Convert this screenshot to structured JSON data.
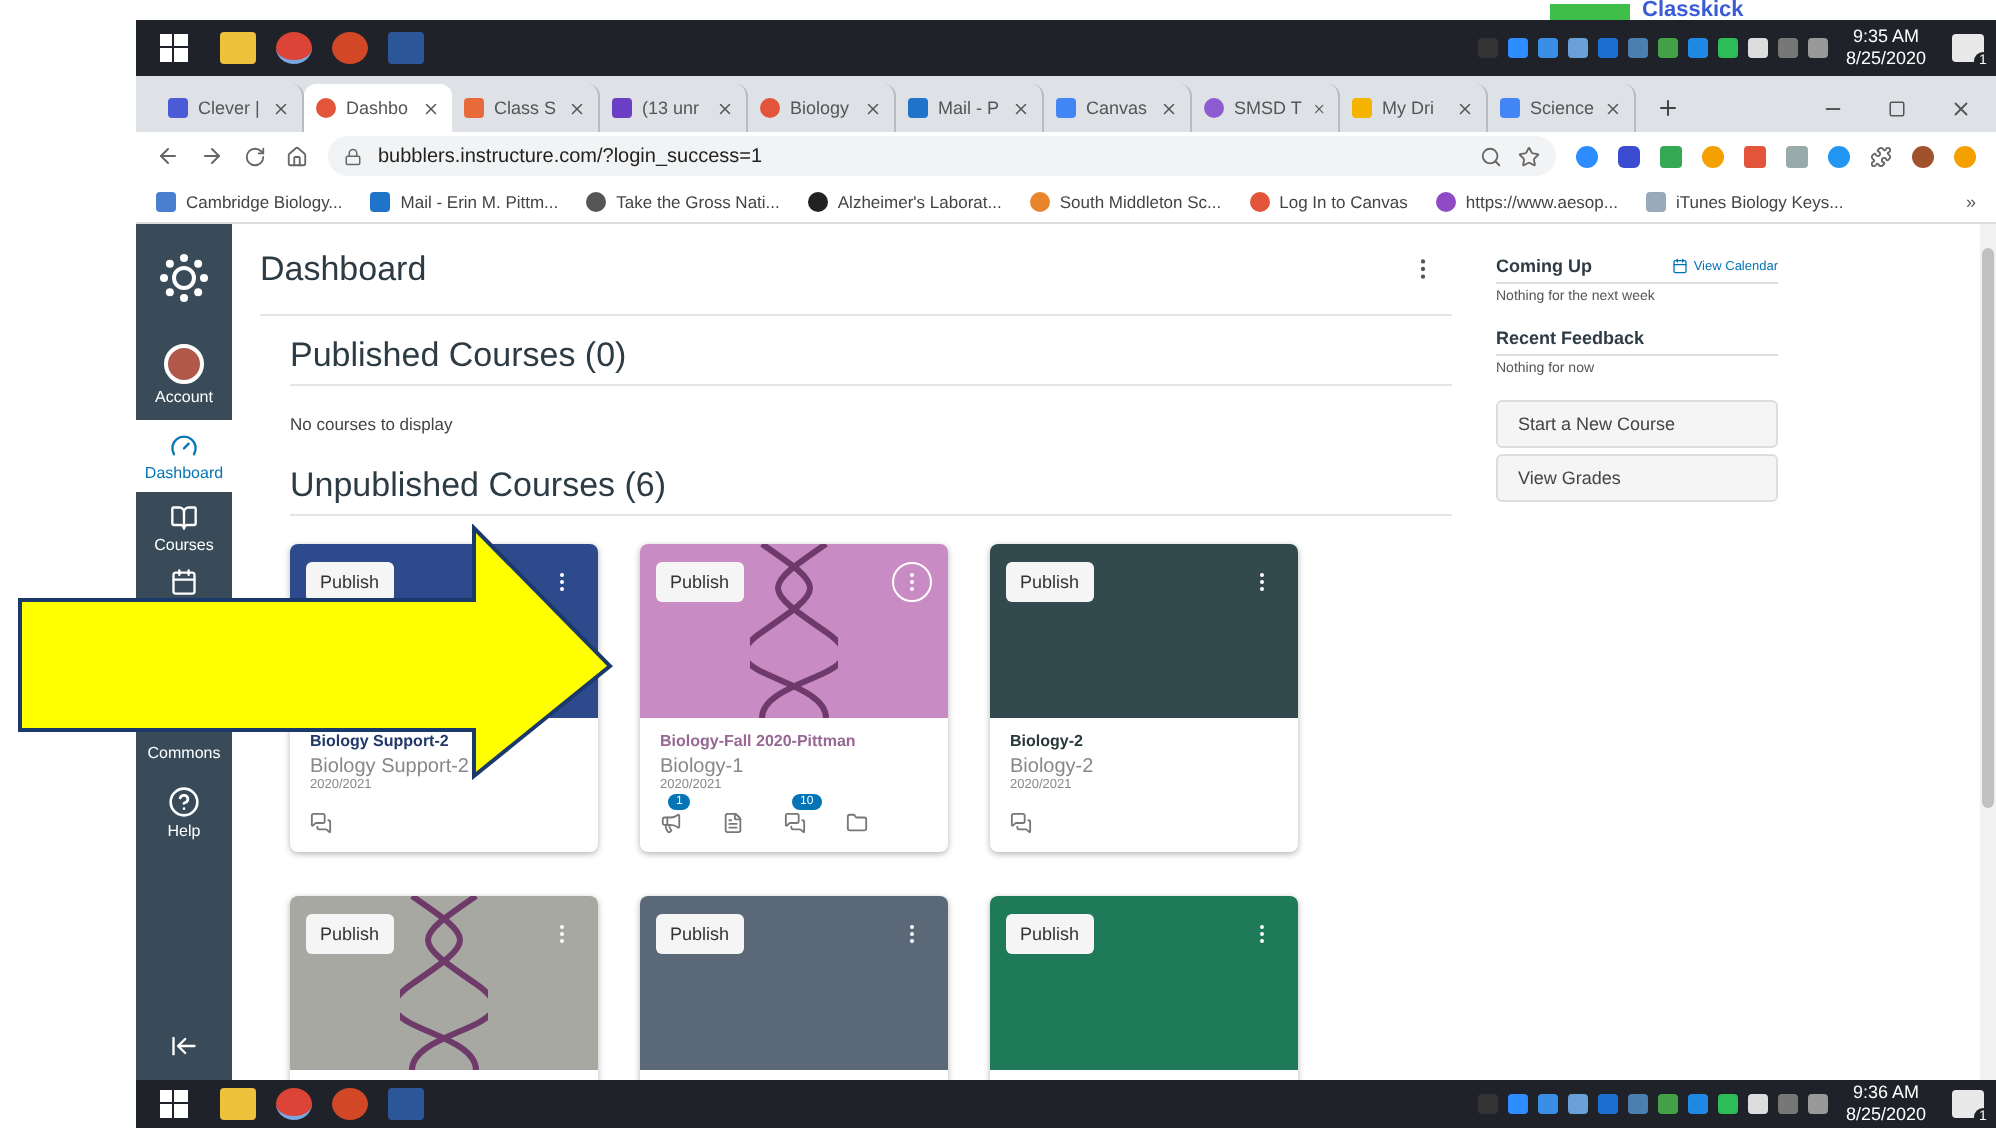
{
  "top_strip": {
    "app_label": "Classkick"
  },
  "taskbar_top": {
    "time": "9:35 AM",
    "date": "8/25/2020",
    "notification_count": "1"
  },
  "browser_tabs": [
    {
      "label": "Clever |",
      "selected": false
    },
    {
      "label": "Dashbo",
      "selected": true
    },
    {
      "label": "Class S",
      "selected": false
    },
    {
      "label": "(13 unr",
      "selected": false
    },
    {
      "label": "Biology",
      "selected": false
    },
    {
      "label": "Mail - P",
      "selected": false
    },
    {
      "label": "Canvas",
      "selected": false
    },
    {
      "label": "SMSD T",
      "selected": false
    },
    {
      "label": "My Dri",
      "selected": false
    },
    {
      "label": "Science",
      "selected": false
    }
  ],
  "address_bar": {
    "url": "bubblers.instructure.com/?login_success=1"
  },
  "bookmarks": [
    "Cambridge Biology...",
    "Mail - Erin M. Pittm...",
    "Take the Gross Nati...",
    "Alzheimer's Laborat...",
    "South Middleton Sc...",
    "Log In to Canvas",
    "https://www.aesop...",
    "iTunes Biology Keys...",
    "»"
  ],
  "nav": [
    {
      "kind": "account",
      "label": "Account",
      "selected": false
    },
    {
      "kind": "dashboard",
      "label": "Dashboard",
      "selected": true
    },
    {
      "kind": "courses",
      "label": "Courses",
      "selected": false
    },
    {
      "kind": "calendar",
      "selected": false
    },
    {
      "kind": "commons",
      "label": "Commons",
      "selected": false
    },
    {
      "kind": "help",
      "label": "Help",
      "selected": false
    }
  ],
  "page": {
    "title": "Dashboard",
    "published_heading": "Published Courses (0)",
    "published_empty": "No courses to display",
    "unpublished_heading": "Unpublished Courses (6)"
  },
  "cards": [
    {
      "kind": "color",
      "color": "#2c4a8c",
      "publish": "Publish",
      "menu_highlighted": false,
      "title": "Biology Support-2",
      "subtitle": "Biology Support-2",
      "term": "2020/2021",
      "actions": [
        {
          "kind": "discussions"
        }
      ]
    },
    {
      "kind": "image",
      "color": "#c98bc4",
      "publish": "Publish",
      "menu_highlighted": true,
      "title": "Biology-Fall 2020-Pittman",
      "subtitle": "Biology-1",
      "term": "2020/2021",
      "actions": [
        {
          "kind": "announcements",
          "badge": "1"
        },
        {
          "kind": "assignments"
        },
        {
          "kind": "discussions",
          "badge": "10"
        },
        {
          "kind": "files"
        }
      ]
    },
    {
      "kind": "color",
      "color": "#324a4d",
      "publish": "Publish",
      "menu_highlighted": false,
      "title": "Biology-2",
      "subtitle": "Biology-2",
      "term": "2020/2021",
      "actions": [
        {
          "kind": "discussions"
        }
      ]
    },
    {
      "kind": "image",
      "color": "#a8a8a2",
      "publish": "Publish",
      "menu_highlighted": false
    },
    {
      "kind": "color",
      "color": "#5b6878",
      "publish": "Publish",
      "menu_highlighted": false
    },
    {
      "kind": "color",
      "color": "#1f7a5a",
      "publish": "Publish",
      "menu_highlighted": false
    }
  ],
  "sidebar": {
    "coming_up": "Coming Up",
    "view_calendar": "View Calendar",
    "coming_up_empty": "Nothing for the next week",
    "recent_feedback": "Recent Feedback",
    "feedback_empty": "Nothing for now",
    "buttons": [
      "Start a New Course",
      "View Grades"
    ]
  },
  "taskbar_bottom": {
    "time": "9:36 AM",
    "date": "8/25/2020",
    "notification_count": "1"
  }
}
